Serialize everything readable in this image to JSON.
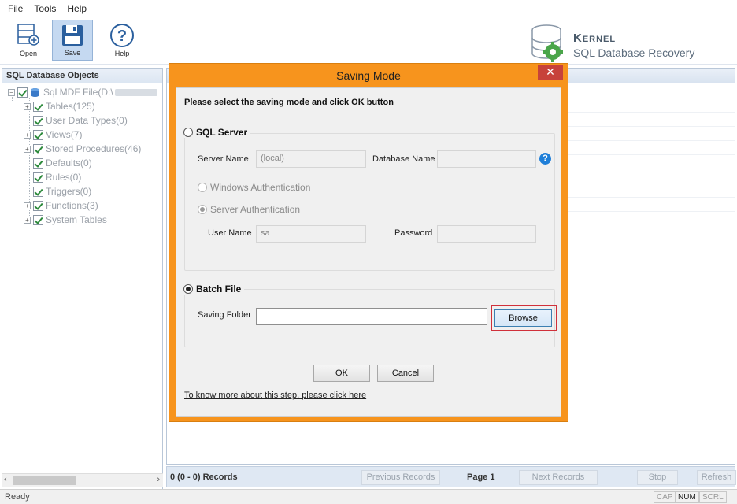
{
  "menu": [
    "File",
    "Tools",
    "Help"
  ],
  "toolbar": {
    "open_label": "Open",
    "save_label": "Save",
    "help_label": "Help"
  },
  "brand": {
    "line1": "Kernel",
    "line2": "SQL Database Recovery"
  },
  "left_panel": {
    "header": "SQL Database Objects",
    "root_label": "Sql MDF File(D:\\",
    "items": [
      "Tables(125)",
      "User Data Types(0)",
      "Views(7)",
      "Stored Procedures(46)",
      "Defaults(0)",
      "Rules(0)",
      "Triggers(0)",
      "Functions(3)",
      "System Tables"
    ]
  },
  "pager": {
    "records": "0 (0 - 0) Records",
    "previous": "Previous Records",
    "page": "Page 1",
    "next": "Next Records",
    "stop": "Stop",
    "refresh": "Refresh"
  },
  "status": {
    "ready": "Ready",
    "cap": "CAP",
    "num": "NUM",
    "scrl": "SCRL"
  },
  "dialog": {
    "title": "Saving Mode",
    "close": "✕",
    "instruction": "Please select the saving mode and click OK button",
    "sql_server": {
      "label": "SQL Server",
      "selected": false,
      "server_name_label": "Server Name",
      "server_name_value": "(local)",
      "database_name_label": "Database Name",
      "database_name_value": "",
      "windows_auth": "Windows Authentication",
      "server_auth": "Server Authentication",
      "server_auth_selected": true,
      "user_name_label": "User Name",
      "user_name_value": "sa",
      "password_label": "Password",
      "password_value": ""
    },
    "batch_file": {
      "label": "Batch File",
      "selected": true,
      "saving_folder_label": "Saving Folder",
      "saving_folder_value": "",
      "browse": "Browse"
    },
    "ok": "OK",
    "cancel": "Cancel",
    "link": "To know more about this step, please click here",
    "help_glyph": "?"
  },
  "colors": {
    "dialog_frame": "#f7941d",
    "close_button": "#c7423a",
    "help_icon": "#1f7fd8",
    "highlight": "#d0303a"
  }
}
